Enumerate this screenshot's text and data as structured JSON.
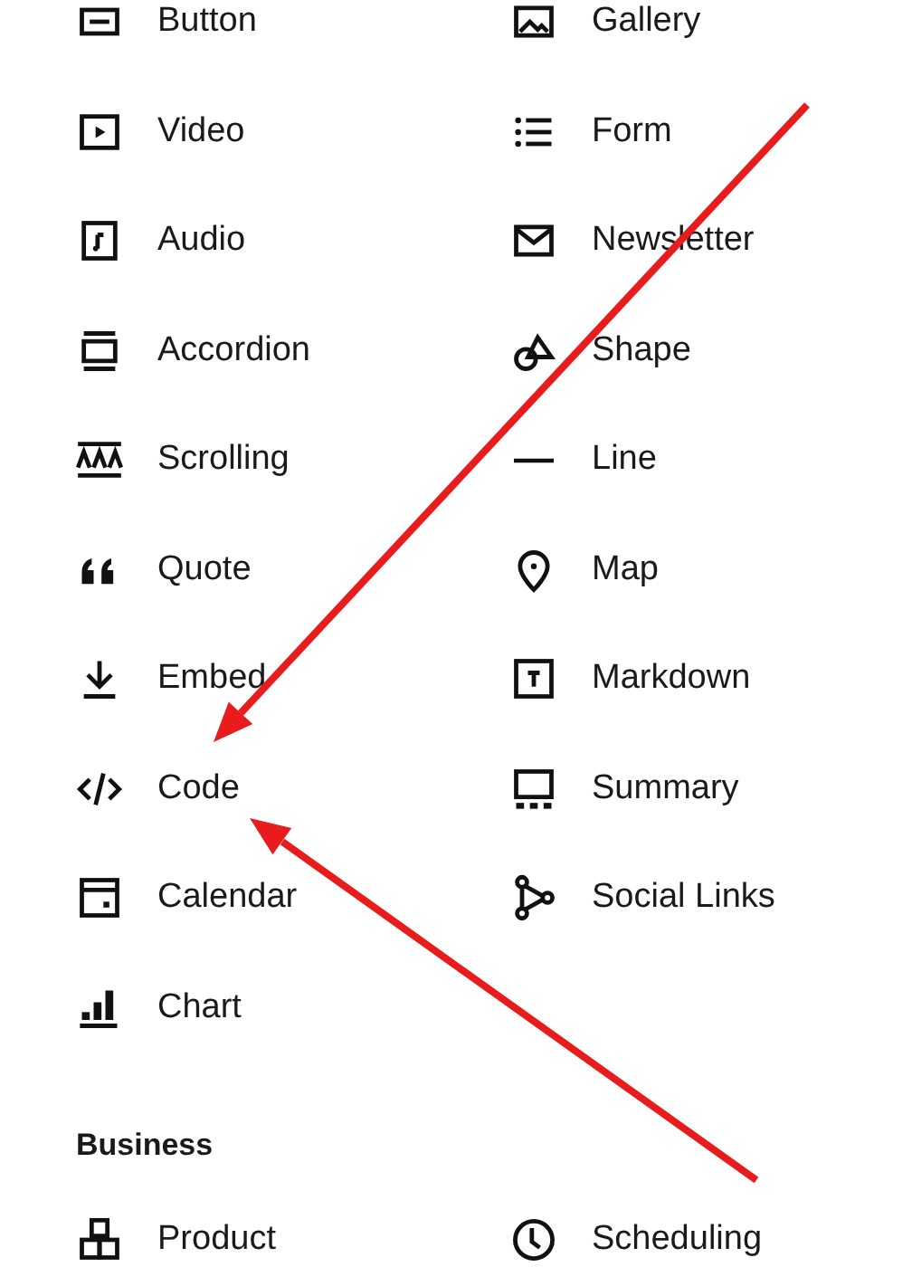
{
  "sections": [
    {
      "items": [
        {
          "label": "Button",
          "kind": "button"
        },
        {
          "label": "Gallery",
          "kind": "gallery"
        },
        {
          "label": "Video",
          "kind": "video"
        },
        {
          "label": "Form",
          "kind": "form"
        },
        {
          "label": "Audio",
          "kind": "audio"
        },
        {
          "label": "Newsletter",
          "kind": "newsletter"
        },
        {
          "label": "Accordion",
          "kind": "accordion"
        },
        {
          "label": "Shape",
          "kind": "shape"
        },
        {
          "label": "Scrolling",
          "kind": "scrolling"
        },
        {
          "label": "Line",
          "kind": "line"
        },
        {
          "label": "Quote",
          "kind": "quote"
        },
        {
          "label": "Map",
          "kind": "map"
        },
        {
          "label": "Embed",
          "kind": "embed"
        },
        {
          "label": "Markdown",
          "kind": "markdown"
        },
        {
          "label": "Code",
          "kind": "code"
        },
        {
          "label": "Summary",
          "kind": "summary"
        },
        {
          "label": "Calendar",
          "kind": "calendar"
        },
        {
          "label": "Social Links",
          "kind": "social"
        },
        {
          "label": "Chart",
          "kind": "chart"
        }
      ]
    },
    {
      "title": "Business",
      "items": [
        {
          "label": "Product",
          "kind": "product"
        },
        {
          "label": "Scheduling",
          "kind": "scheduling"
        }
      ]
    }
  ]
}
